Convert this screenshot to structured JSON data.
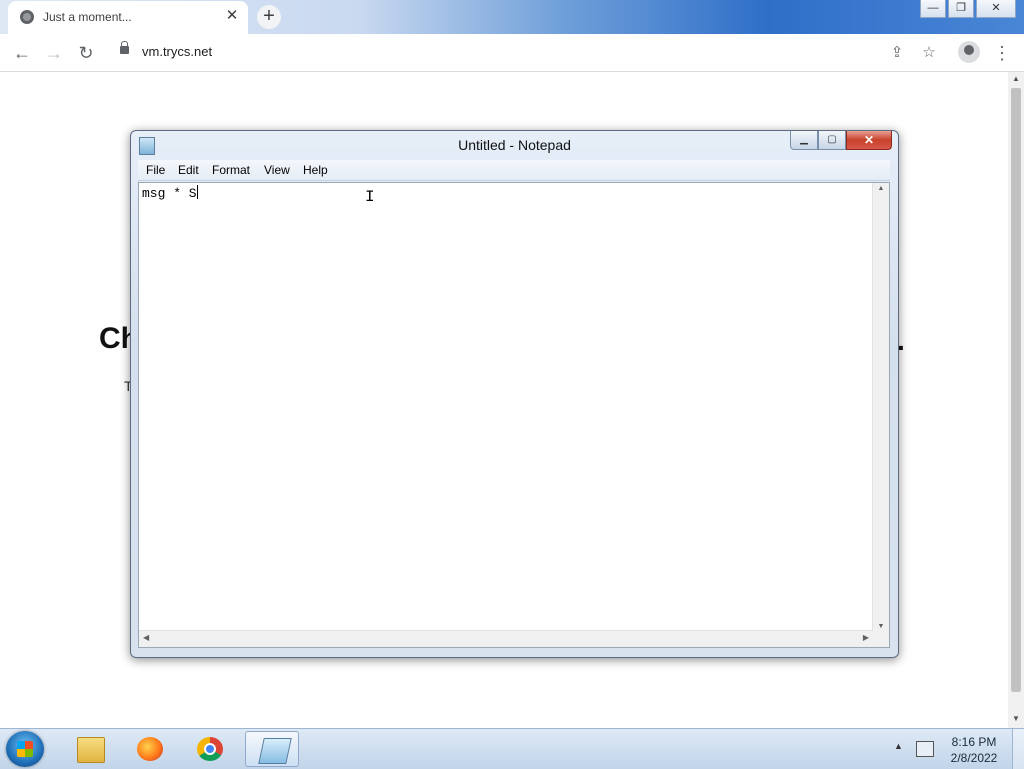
{
  "browser": {
    "tab_title": "Just a moment...",
    "tab_close": "✕",
    "new_tab": "+",
    "url": "vm.trycs.net",
    "window_buttons": {
      "minimize": "—",
      "restore": "❐",
      "close": "✕"
    },
    "icons": {
      "back": "←",
      "forward": "→",
      "reload": "↻",
      "share": "⇪",
      "bookmark": "☆",
      "menu": "⋮"
    }
  },
  "page": {
    "heading_fragment": "Ch",
    "heading_end": ".",
    "sub_fragment": "T"
  },
  "notepad": {
    "title": "Untitled - Notepad",
    "caption_buttons": {
      "minimize": "▁",
      "maximize": "▢",
      "close": "✕"
    },
    "menu": [
      "File",
      "Edit",
      "Format",
      "View",
      "Help"
    ],
    "content": "msg * S"
  },
  "taskbar": {
    "time": "8:16 PM",
    "date": "2/8/2022",
    "apps": [
      "file-explorer",
      "firefox",
      "chrome",
      "notepad"
    ],
    "active_app": "notepad"
  }
}
